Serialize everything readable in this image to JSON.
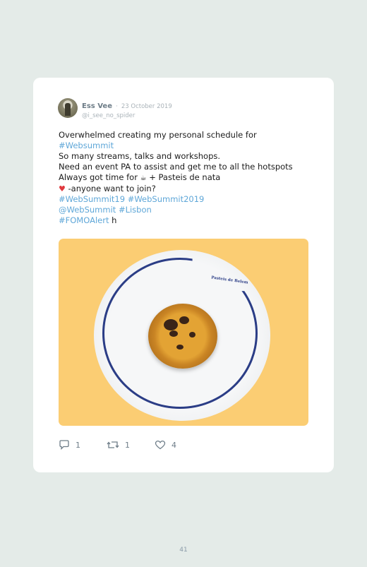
{
  "tweet": {
    "display_name": "Ess Vee",
    "separator": "·",
    "date": "23 October 2019",
    "handle": "@i_see_no_spider",
    "lines": [
      "Overwhelmed creating my personal schedule for",
      "#Websummit",
      "So many streams, talks and workshops.",
      "Need an event PA to assist and get me to all the hotspots",
      "Always got time for",
      "+ Pasteis de nata",
      "-anyone want to join?",
      "#WebSummit19",
      "#WebSummit2019",
      "@WebSummit",
      "#Lisbon",
      "#FOMOAlert",
      "h"
    ],
    "emoji": {
      "coffee": "☕",
      "heart": "♥"
    },
    "photo": {
      "plate_logo": "Pasteis de Belem"
    },
    "actions": {
      "replies": "1",
      "retweets": "1",
      "likes": "4"
    }
  },
  "page_number": "41",
  "colors": {
    "background": "#e4ebe8",
    "card": "#ffffff",
    "link": "#5fa7d8",
    "photo_background": "#fbcd73",
    "plate_rim": "#2b3d86"
  },
  "icons": [
    "reply-icon",
    "retweet-icon",
    "like-icon",
    "coffee-emoji",
    "heart-emoji"
  ]
}
